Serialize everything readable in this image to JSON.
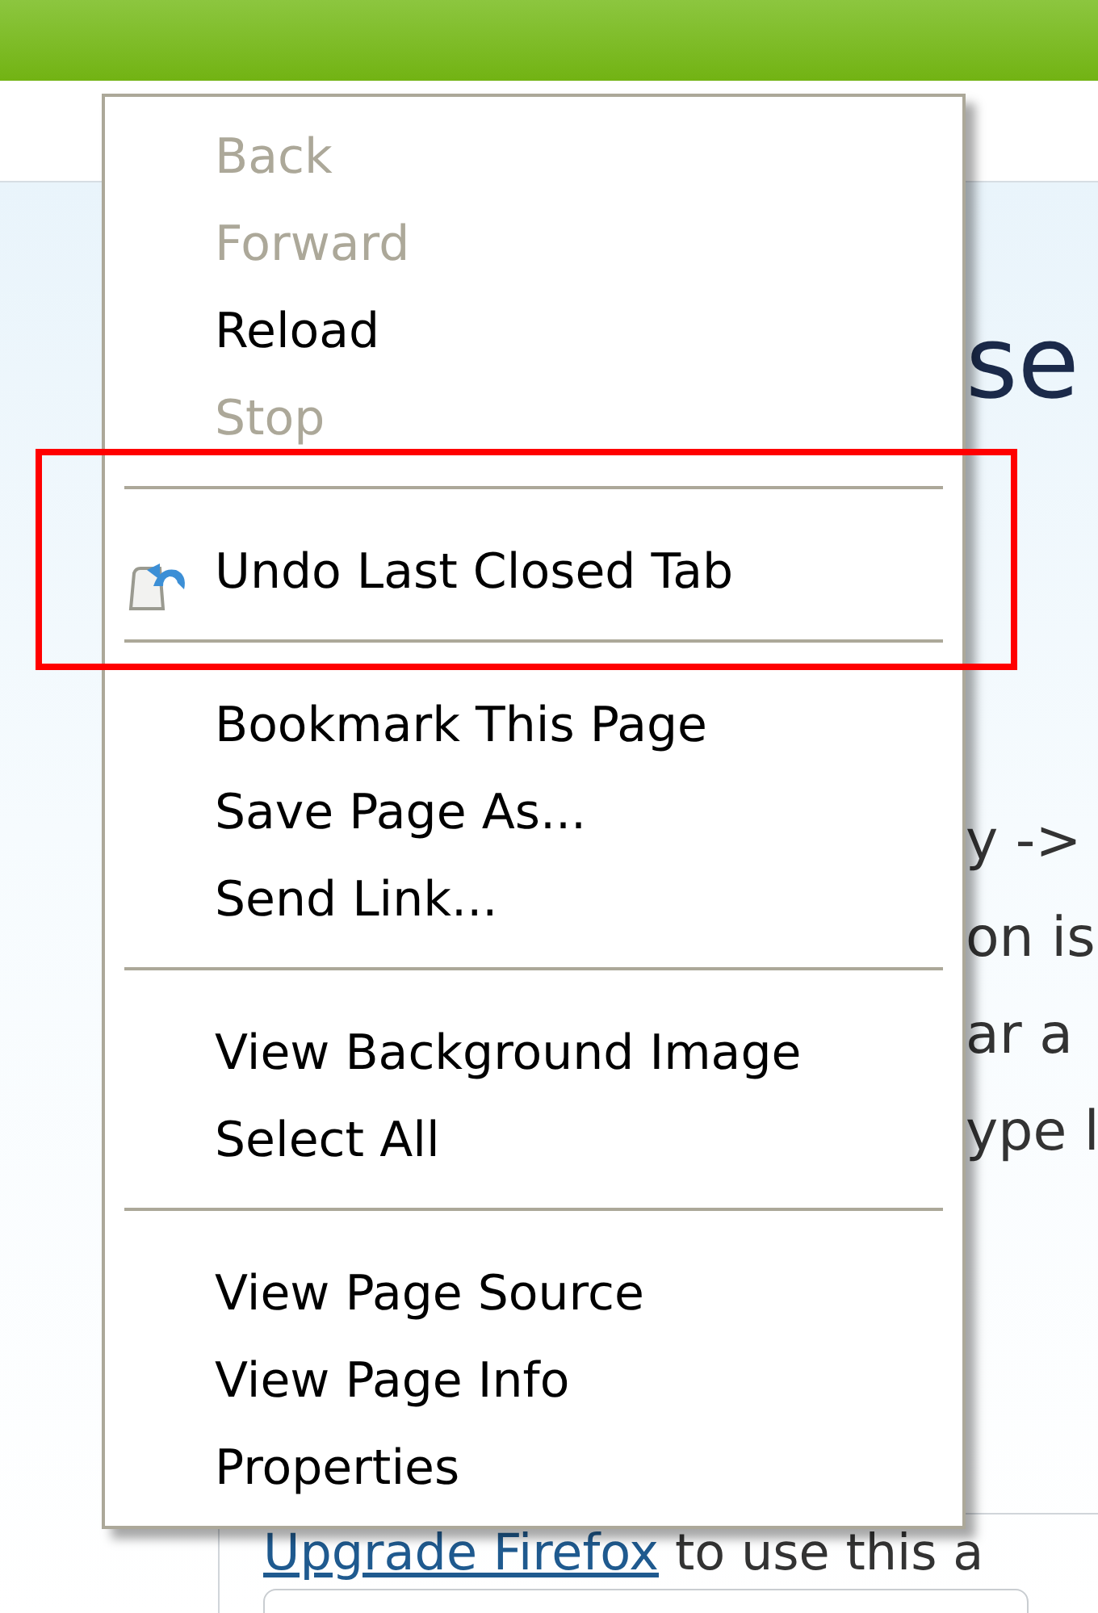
{
  "page": {
    "heading": "se",
    "lines": [
      "y ->",
      "on is",
      "ar a",
      "ype l"
    ],
    "link": "Upgrade Firefox",
    "link_rest": "to use this a"
  },
  "context_menu": {
    "items": [
      {
        "kind": "item",
        "label": "Back",
        "disabled": true
      },
      {
        "kind": "item",
        "label": "Forward",
        "disabled": true
      },
      {
        "kind": "item",
        "label": "Reload",
        "disabled": false
      },
      {
        "kind": "item",
        "label": "Stop",
        "disabled": true
      },
      {
        "kind": "separator"
      },
      {
        "kind": "icon_item",
        "label": "Undo Last Closed Tab",
        "disabled": false
      },
      {
        "kind": "separator"
      },
      {
        "kind": "item",
        "label": "Bookmark This Page",
        "disabled": false
      },
      {
        "kind": "item",
        "label": "Save Page As...",
        "disabled": false
      },
      {
        "kind": "item",
        "label": "Send Link...",
        "disabled": false
      },
      {
        "kind": "separator"
      },
      {
        "kind": "item",
        "label": "View Background Image",
        "disabled": false
      },
      {
        "kind": "item",
        "label": "Select All",
        "disabled": false
      },
      {
        "kind": "separator"
      },
      {
        "kind": "item",
        "label": "View Page Source",
        "disabled": false
      },
      {
        "kind": "item",
        "label": "View Page Info",
        "disabled": false
      },
      {
        "kind": "item",
        "label": "Properties",
        "disabled": false
      }
    ]
  }
}
